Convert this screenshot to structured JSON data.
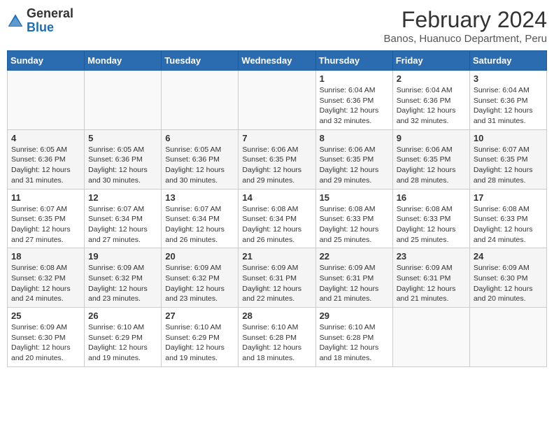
{
  "app": {
    "logo_general": "General",
    "logo_blue": "Blue",
    "title": "February 2024",
    "subtitle": "Banos, Huanuco Department, Peru"
  },
  "calendar": {
    "headers": [
      "Sunday",
      "Monday",
      "Tuesday",
      "Wednesday",
      "Thursday",
      "Friday",
      "Saturday"
    ],
    "weeks": [
      [
        {
          "day": "",
          "info": ""
        },
        {
          "day": "",
          "info": ""
        },
        {
          "day": "",
          "info": ""
        },
        {
          "day": "",
          "info": ""
        },
        {
          "day": "1",
          "info": "Sunrise: 6:04 AM\nSunset: 6:36 PM\nDaylight: 12 hours\nand 32 minutes."
        },
        {
          "day": "2",
          "info": "Sunrise: 6:04 AM\nSunset: 6:36 PM\nDaylight: 12 hours\nand 32 minutes."
        },
        {
          "day": "3",
          "info": "Sunrise: 6:04 AM\nSunset: 6:36 PM\nDaylight: 12 hours\nand 31 minutes."
        }
      ],
      [
        {
          "day": "4",
          "info": "Sunrise: 6:05 AM\nSunset: 6:36 PM\nDaylight: 12 hours\nand 31 minutes."
        },
        {
          "day": "5",
          "info": "Sunrise: 6:05 AM\nSunset: 6:36 PM\nDaylight: 12 hours\nand 30 minutes."
        },
        {
          "day": "6",
          "info": "Sunrise: 6:05 AM\nSunset: 6:36 PM\nDaylight: 12 hours\nand 30 minutes."
        },
        {
          "day": "7",
          "info": "Sunrise: 6:06 AM\nSunset: 6:35 PM\nDaylight: 12 hours\nand 29 minutes."
        },
        {
          "day": "8",
          "info": "Sunrise: 6:06 AM\nSunset: 6:35 PM\nDaylight: 12 hours\nand 29 minutes."
        },
        {
          "day": "9",
          "info": "Sunrise: 6:06 AM\nSunset: 6:35 PM\nDaylight: 12 hours\nand 28 minutes."
        },
        {
          "day": "10",
          "info": "Sunrise: 6:07 AM\nSunset: 6:35 PM\nDaylight: 12 hours\nand 28 minutes."
        }
      ],
      [
        {
          "day": "11",
          "info": "Sunrise: 6:07 AM\nSunset: 6:35 PM\nDaylight: 12 hours\nand 27 minutes."
        },
        {
          "day": "12",
          "info": "Sunrise: 6:07 AM\nSunset: 6:34 PM\nDaylight: 12 hours\nand 27 minutes."
        },
        {
          "day": "13",
          "info": "Sunrise: 6:07 AM\nSunset: 6:34 PM\nDaylight: 12 hours\nand 26 minutes."
        },
        {
          "day": "14",
          "info": "Sunrise: 6:08 AM\nSunset: 6:34 PM\nDaylight: 12 hours\nand 26 minutes."
        },
        {
          "day": "15",
          "info": "Sunrise: 6:08 AM\nSunset: 6:33 PM\nDaylight: 12 hours\nand 25 minutes."
        },
        {
          "day": "16",
          "info": "Sunrise: 6:08 AM\nSunset: 6:33 PM\nDaylight: 12 hours\nand 25 minutes."
        },
        {
          "day": "17",
          "info": "Sunrise: 6:08 AM\nSunset: 6:33 PM\nDaylight: 12 hours\nand 24 minutes."
        }
      ],
      [
        {
          "day": "18",
          "info": "Sunrise: 6:08 AM\nSunset: 6:32 PM\nDaylight: 12 hours\nand 24 minutes."
        },
        {
          "day": "19",
          "info": "Sunrise: 6:09 AM\nSunset: 6:32 PM\nDaylight: 12 hours\nand 23 minutes."
        },
        {
          "day": "20",
          "info": "Sunrise: 6:09 AM\nSunset: 6:32 PM\nDaylight: 12 hours\nand 23 minutes."
        },
        {
          "day": "21",
          "info": "Sunrise: 6:09 AM\nSunset: 6:31 PM\nDaylight: 12 hours\nand 22 minutes."
        },
        {
          "day": "22",
          "info": "Sunrise: 6:09 AM\nSunset: 6:31 PM\nDaylight: 12 hours\nand 21 minutes."
        },
        {
          "day": "23",
          "info": "Sunrise: 6:09 AM\nSunset: 6:31 PM\nDaylight: 12 hours\nand 21 minutes."
        },
        {
          "day": "24",
          "info": "Sunrise: 6:09 AM\nSunset: 6:30 PM\nDaylight: 12 hours\nand 20 minutes."
        }
      ],
      [
        {
          "day": "25",
          "info": "Sunrise: 6:09 AM\nSunset: 6:30 PM\nDaylight: 12 hours\nand 20 minutes."
        },
        {
          "day": "26",
          "info": "Sunrise: 6:10 AM\nSunset: 6:29 PM\nDaylight: 12 hours\nand 19 minutes."
        },
        {
          "day": "27",
          "info": "Sunrise: 6:10 AM\nSunset: 6:29 PM\nDaylight: 12 hours\nand 19 minutes."
        },
        {
          "day": "28",
          "info": "Sunrise: 6:10 AM\nSunset: 6:28 PM\nDaylight: 12 hours\nand 18 minutes."
        },
        {
          "day": "29",
          "info": "Sunrise: 6:10 AM\nSunset: 6:28 PM\nDaylight: 12 hours\nand 18 minutes."
        },
        {
          "day": "",
          "info": ""
        },
        {
          "day": "",
          "info": ""
        }
      ]
    ]
  }
}
